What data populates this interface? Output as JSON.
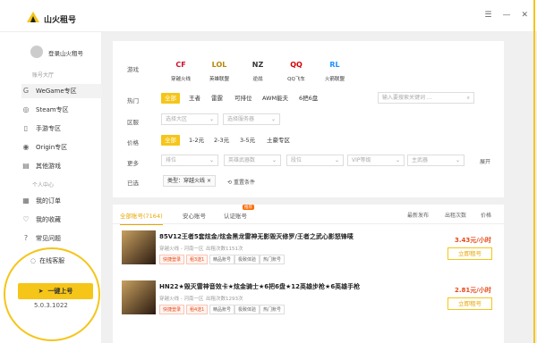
{
  "app": {
    "name": "山火租号",
    "version": "5.0.3.1022"
  },
  "window_controls": [
    "☰",
    "—",
    "✕"
  ],
  "sidebar": {
    "login_text": "登录山火租号",
    "section1": "账号大厅",
    "items": [
      {
        "label": "WeGame专区",
        "icon": "wegame-icon",
        "glyph": "G",
        "active": true
      },
      {
        "label": "Steam专区",
        "icon": "steam-icon",
        "glyph": "◎",
        "active": false
      },
      {
        "label": "手游专区",
        "icon": "mobile-icon",
        "glyph": "▯",
        "active": false
      },
      {
        "label": "Origin专区",
        "icon": "origin-icon",
        "glyph": "◉",
        "active": false
      },
      {
        "label": "其他游戏",
        "icon": "gamepad-icon",
        "glyph": "▤",
        "active": false
      }
    ],
    "section2": "个人中心",
    "personal": [
      {
        "label": "我的订单",
        "icon": "order-icon",
        "glyph": "▦"
      },
      {
        "label": "我的收藏",
        "icon": "heart-icon",
        "glyph": "♡"
      },
      {
        "label": "常见问题",
        "icon": "question-icon",
        "glyph": "?"
      }
    ],
    "online_service": "在线客服",
    "one_key_button": "一键上号"
  },
  "filters": {
    "game_label": "游戏",
    "games": [
      {
        "name": "穿越火线",
        "logo": "CF",
        "color": "#c8102e"
      },
      {
        "name": "英雄联盟",
        "logo": "LOL",
        "color": "#b8860b"
      },
      {
        "name": "逆战",
        "logo": "NZ",
        "color": "#333"
      },
      {
        "name": "QQ飞车",
        "logo": "QQ",
        "color": "#d40000"
      },
      {
        "name": "火箭联盟",
        "logo": "RL",
        "color": "#1e90ff"
      }
    ],
    "hot_label": "热门",
    "hot_tags": [
      "全部",
      "王者",
      "雷霆",
      "可排位",
      "AWM能夫",
      "6把6盘"
    ],
    "search_placeholder": "输入要搜索关键词 ...",
    "region_label": "区服",
    "region_selects": [
      "选择大区",
      "选择服务器"
    ],
    "price_label": "价格",
    "price_tags": [
      "全部",
      "1-2元",
      "2-3元",
      "3-5元",
      "土豪专区"
    ],
    "more_label": "更多",
    "more_selects": [
      "排位",
      "英雄武器数",
      "段位",
      "VIP等级",
      "主武器"
    ],
    "expand_label": "展开",
    "selected_label": "已选",
    "selected_chip": "类型：穿越火线",
    "reset_label": "重置条件"
  },
  "list": {
    "tabs": [
      "全部账号(7164)",
      "安心账号",
      "认证账号"
    ],
    "hot_badge": "推荐",
    "sort": [
      "最新发布",
      "出租次数",
      "价格"
    ],
    "items": [
      {
        "title": "85V12王者5套炫金/炫金黑龙雷神无影毁灭修罗/王者之武心影怒锋唛",
        "sub": "穿越火线 - 河南一区",
        "sub2": "出租次数1151次",
        "badges": [
          "快捷登录",
          "租3送1",
          "精品账号",
          "极致体验",
          "热门账号"
        ],
        "price": "3.43元/小时",
        "rent": "立即租号"
      },
      {
        "title": "HN22★毁灭雷神音效卡★炫金骑士★6把6盘★12英雄步枪★6英雄手枪",
        "sub": "穿越火线 - 河南一区",
        "sub2": "出租次数1293次",
        "badges": [
          "快捷登录",
          "租4送1",
          "精品账号",
          "极致体验",
          "热门账号"
        ],
        "price": "2.81元/小时",
        "rent": "立即租号"
      }
    ]
  }
}
